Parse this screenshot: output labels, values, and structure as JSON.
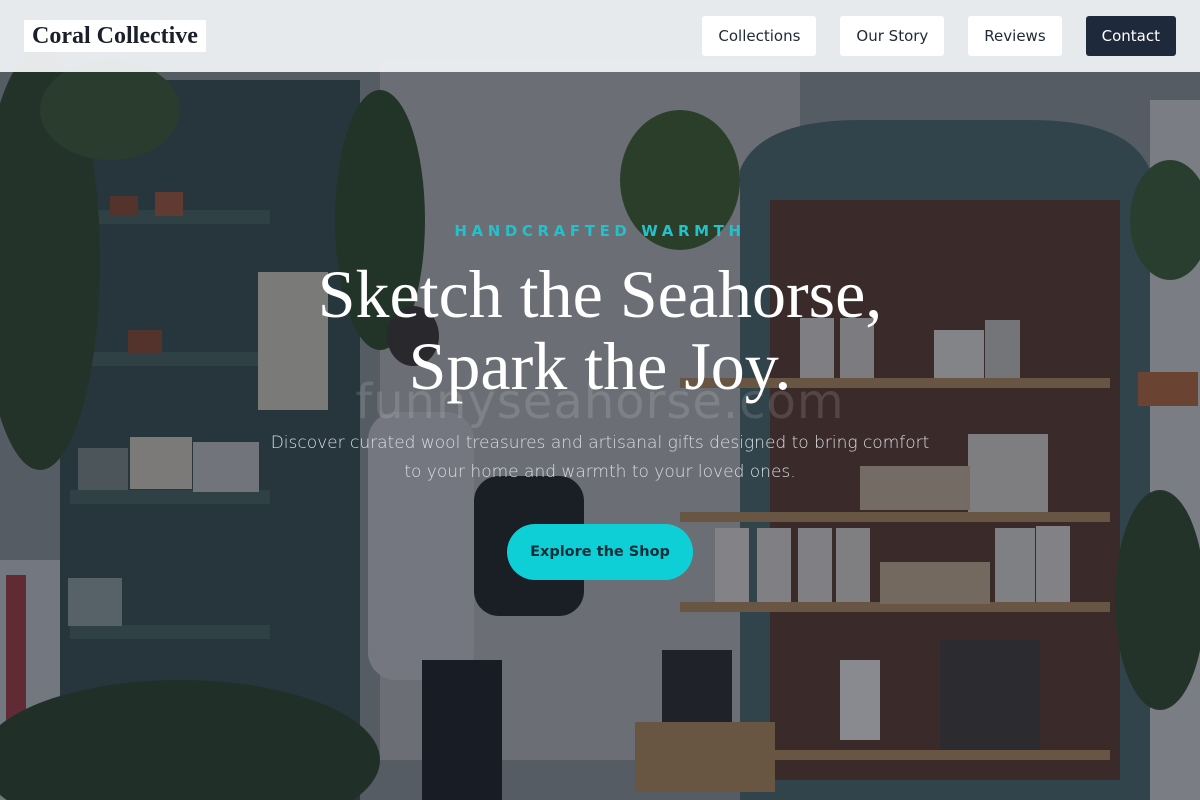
{
  "brand": {
    "name": "Coral Collective"
  },
  "nav": {
    "items": [
      {
        "label": "Collections"
      },
      {
        "label": "Our Story"
      },
      {
        "label": "Reviews"
      },
      {
        "label": "Contact"
      }
    ]
  },
  "hero": {
    "eyebrow": "HANDCRAFTED WARMTH",
    "headline_line1": "Sketch the Seahorse,",
    "headline_line2": "Spark the Joy.",
    "watermark": "funnyseahorse.com",
    "subtitle": "Discover curated wool treasures and artisanal gifts designed to bring comfort to your home and warmth to your loved ones.",
    "cta_label": "Explore the Shop"
  },
  "colors": {
    "accent": "#0fcfd6",
    "eyebrow": "#22c1cc",
    "nav_dark": "#1e293b",
    "nav_bg": "#eceef1"
  }
}
